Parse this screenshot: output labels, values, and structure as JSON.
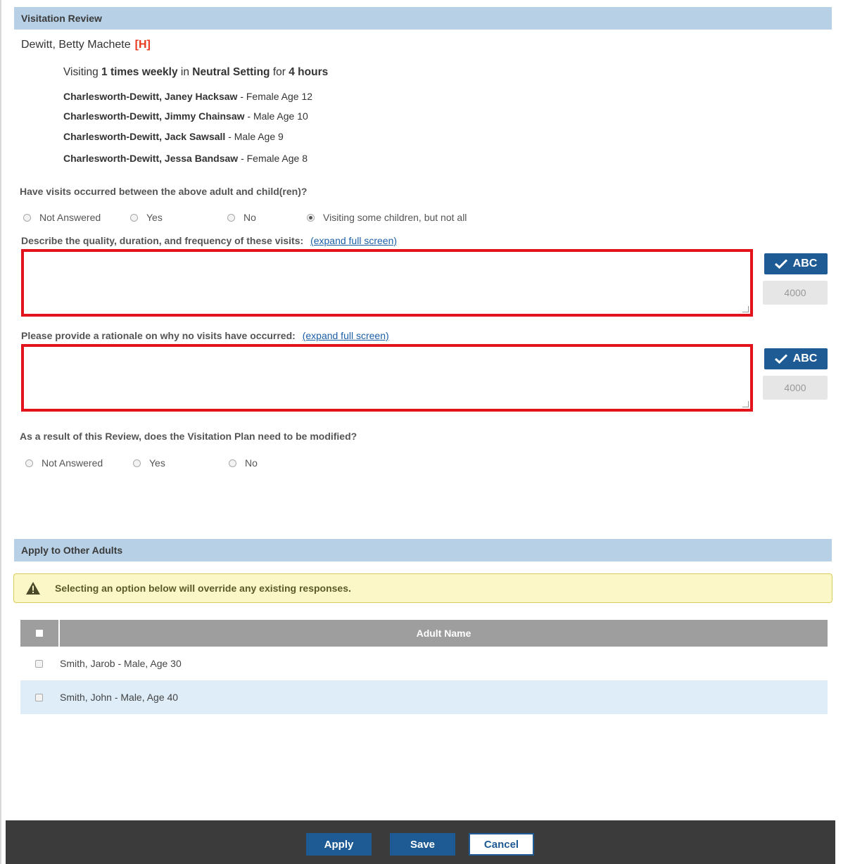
{
  "visitation_review": {
    "header": "Visitation Review",
    "person_name": "Dewitt, Betty Machete",
    "person_flag": "[H]",
    "summary": {
      "prefix": "Visiting",
      "count": "1",
      "times_text": "times weekly",
      "in_text": "in",
      "setting": "Neutral Setting",
      "for_text": "for",
      "hours": "4 hours"
    },
    "children": [
      {
        "name": "Charlesworth-Dewitt, Janey Hacksaw",
        "details": "- Female  Age 12"
      },
      {
        "name": "Charlesworth-Dewitt, Jimmy Chainsaw",
        "details": "- Male  Age 10"
      },
      {
        "name": "Charlesworth-Dewitt, Jack Sawsall",
        "details": "- Male  Age 9"
      },
      {
        "name": "Charlesworth-Dewitt, Jessa Bandsaw",
        "details": "- Female  Age 8"
      }
    ],
    "q1": {
      "text": "Have visits occurred between the above adult and child(ren)?",
      "options": [
        "Not Answered",
        "Yes",
        "No",
        "Visiting some children, but not all"
      ],
      "selected": "Visiting some children, but not all"
    },
    "q2": {
      "text": "Describe the quality, duration, and frequency of these visits:",
      "link": "(expand full screen)",
      "value": "",
      "spell_label": "ABC",
      "counter": "4000"
    },
    "q3": {
      "text": "Please provide a rationale on why no visits have occurred:",
      "link": "(expand full screen)",
      "value": "",
      "spell_label": "ABC",
      "counter": "4000"
    },
    "q4": {
      "text": "As a result of this Review, does the Visitation Plan need to be modified?",
      "options": [
        "Not Answered",
        "Yes",
        "No"
      ],
      "selected": ""
    }
  },
  "apply_other": {
    "header": "Apply to Other Adults",
    "warning": "Selecting an option below will override any existing responses.",
    "column_header": "Adult Name",
    "rows": [
      {
        "name": "Smith, Jarob  -  Male, Age 30"
      },
      {
        "name": "Smith, John  -  Male, Age 40"
      }
    ]
  },
  "footer": {
    "apply_label": "Apply",
    "save_label": "Save",
    "cancel_label": "Cancel"
  },
  "colors": {
    "section_header": "#b7d0e6",
    "primary_button": "#1e5a94",
    "highlight_border": "#e3131b",
    "warning_bg": "#fbf7c7",
    "alt_row": "#deedf8"
  }
}
